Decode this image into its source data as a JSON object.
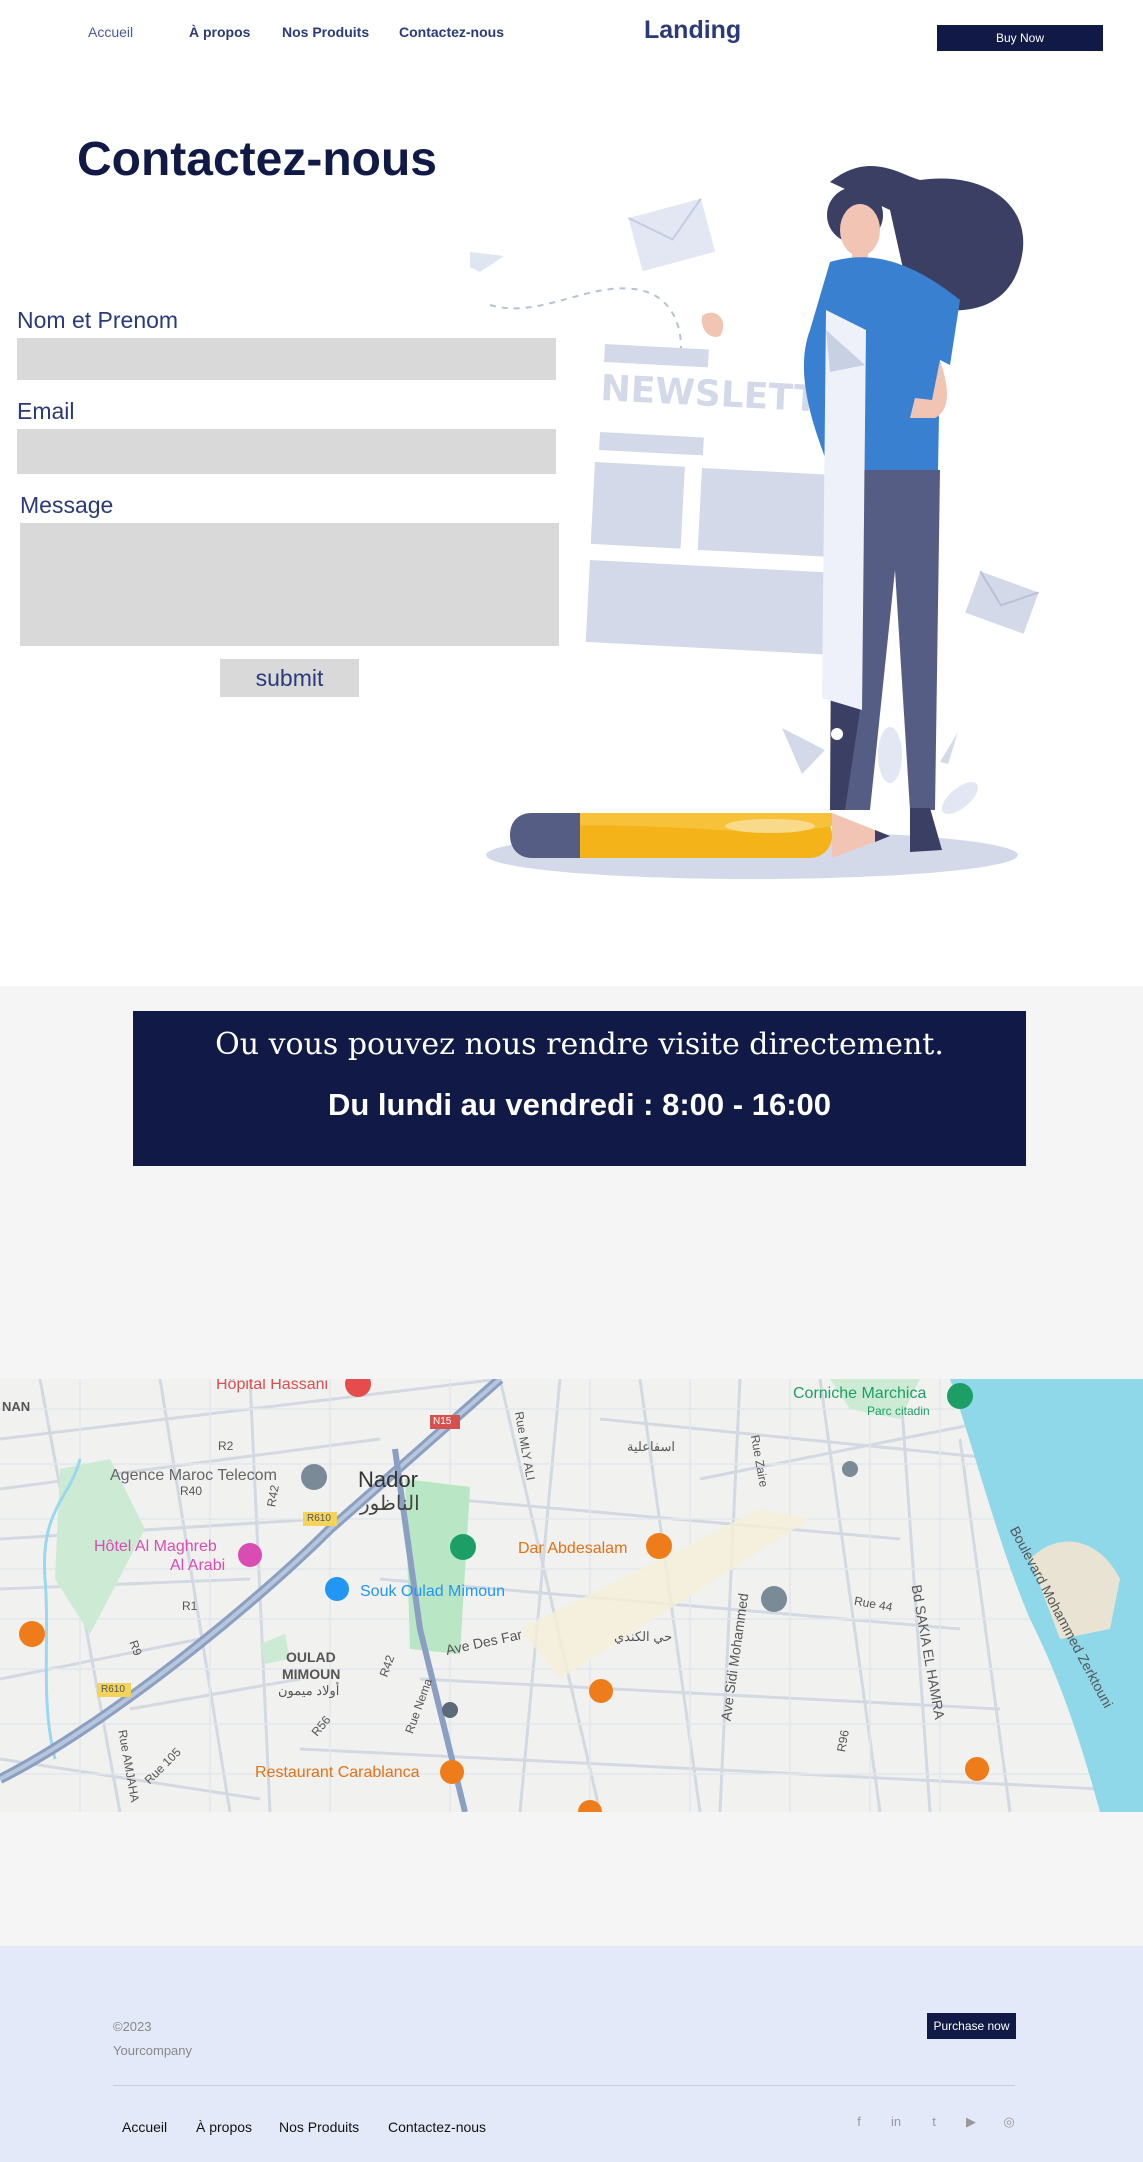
{
  "nav": {
    "links": [
      "Accueil",
      "À propos",
      "Nos Produits",
      "Contactez-nous"
    ],
    "brand": "Landing",
    "buy_label": "Buy Now"
  },
  "contact": {
    "title": "Contactez-nous",
    "name_label": "Nom et Prenom",
    "email_label": "Email",
    "message_label": "Message",
    "submit_label": "submit",
    "illustration_text": "NEWSLETTER"
  },
  "visit": {
    "line1": "Ou vous pouvez nous rendre visite directement.",
    "line2": "Du lundi au vendredi : 8:00 - 16:00"
  },
  "map": {
    "places": [
      "Hôpital Hassani",
      "Agence Maroc Telecom",
      "Nador",
      "الناظور",
      "Hôtel Al Maghreb",
      "Al Arabi",
      "Souk Oulad Mimoun",
      "Dar Abdesalam",
      "OULAD",
      "MIMOUN",
      "أولاد ميمون",
      "Restaurant Carablanca",
      "Corniche Marchica",
      "Parc citadin",
      "Ave Des Far",
      "Ave Sidi Mohammed",
      "Bd SAKIA EL HAMRA",
      "Boulevard Mohammed Zerktouni",
      "Rue Zaire",
      "Rue 44",
      "Rue Nema",
      "Rue AMJAHA",
      "Rue 105",
      "Rue MLY ALI",
      "حي الكندي",
      "اسفاعلية",
      "NAN"
    ],
    "roads": [
      "N15",
      "R610",
      "R610",
      "R2",
      "R40",
      "R42",
      "R1",
      "R9",
      "R42",
      "R56",
      "R96"
    ],
    "colors": {
      "water": "#8ed8ea",
      "park": "#b9e6c4",
      "road_main": "#8a9fc2"
    }
  },
  "footer": {
    "copyright": "©2023",
    "company": "Yourcompany",
    "purchase_label": "Purchase now",
    "links": [
      "Accueil",
      "À propos",
      "Nos Produits",
      "Contactez-nous"
    ],
    "social": [
      "f",
      "in",
      "t",
      "▶",
      "◎"
    ]
  },
  "colors": {
    "navy": "#111a47",
    "indigo": "#2b3a7a",
    "field": "#d9d9d9",
    "footer_bg": "#e4e9f9"
  }
}
